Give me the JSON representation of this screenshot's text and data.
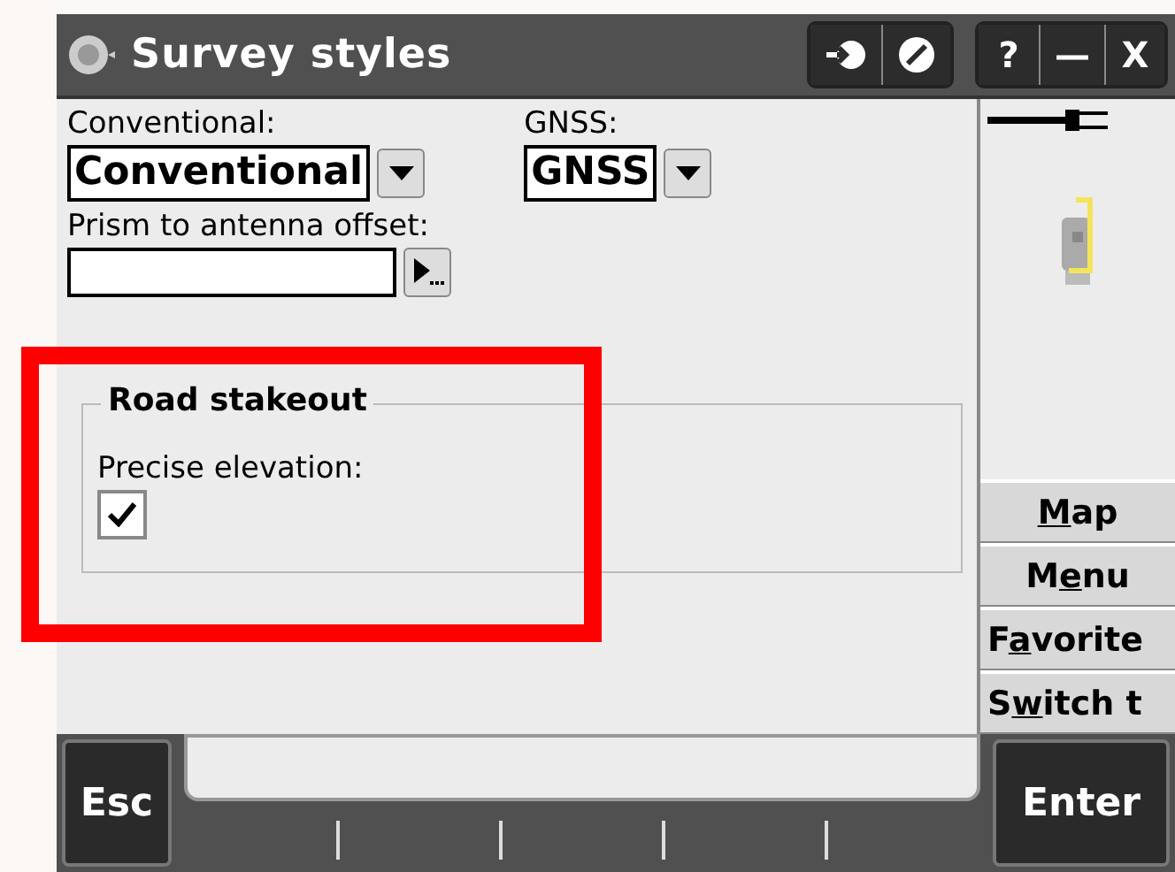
{
  "window": {
    "title": "Survey styles",
    "title_buttons": [
      "?",
      "—",
      "X"
    ]
  },
  "form": {
    "conventional": {
      "label": "Conventional:",
      "value": "Conventional"
    },
    "gnss": {
      "label": "GNSS:",
      "value": "GNSS"
    },
    "prism_offset": {
      "label": "Prism to antenna offset:"
    }
  },
  "road_stakeout": {
    "title": "Road stakeout",
    "precise_elevation": {
      "label": "Precise elevation:",
      "checked": true
    }
  },
  "side_buttons": [
    {
      "key": "M",
      "after": "ap"
    },
    {
      "before": "M",
      "key": "e",
      "after": "nu"
    },
    {
      "before": "F",
      "key": "a",
      "after": "vorite"
    },
    {
      "before": "S",
      "key": "w",
      "after": "itch t"
    }
  ],
  "softkeys": {
    "left": "Esc",
    "right": "Enter"
  }
}
